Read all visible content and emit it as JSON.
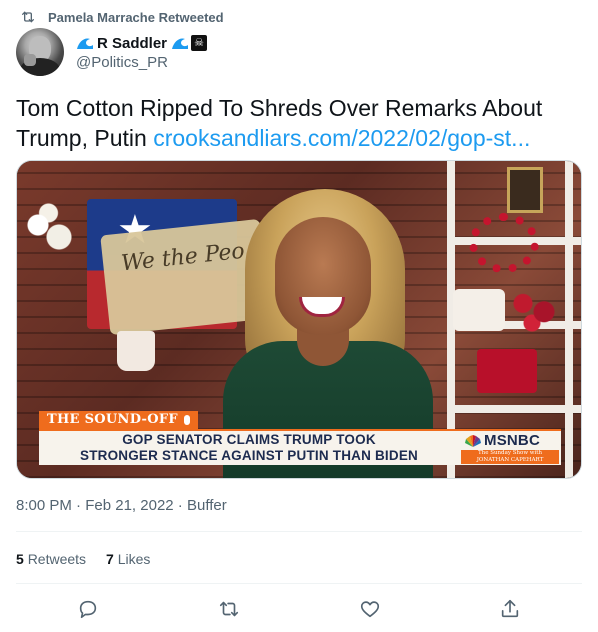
{
  "retweet_bar": {
    "icon": "retweet-icon",
    "text": "Pamela Marrache Retweeted"
  },
  "author": {
    "avatar": "avatar",
    "display_name": "R Saddler",
    "badges": [
      "wave-icon",
      "wave-icon",
      "pirate-flag-icon"
    ],
    "handle": "@Politics_PR"
  },
  "tweet": {
    "text": "Tom Cotton Ripped To Shreds Over Remarks About Trump, Putin ",
    "link": "crooksandliars.com/2022/02/gop-st..."
  },
  "media": {
    "sound_off": "THE SOUND-OFF",
    "headline_line1": "GOP SENATOR CLAIMS TRUMP TOOK",
    "headline_line2": "STRONGER STANCE AGAINST PUTIN THAN BIDEN",
    "network": "MSNBC",
    "show_line1": "The Sunday Show with",
    "show_line2": "JONATHAN CAPEHART",
    "constitution_script": "We the Peo"
  },
  "meta": {
    "time": "8:00 PM",
    "separator": " · ",
    "date": "Feb 21, 2022",
    "source": "Buffer"
  },
  "stats": {
    "retweets_count": "5",
    "retweets_label": "Retweets",
    "likes_count": "7",
    "likes_label": "Likes"
  },
  "actions": {
    "reply": "reply-icon",
    "retweet": "retweet-icon",
    "like": "like-icon",
    "share": "share-icon"
  },
  "colors": {
    "link": "#1d9bf0",
    "secondary_text": "#536471",
    "primary_text": "#0f1419",
    "divider": "#eff3f4",
    "msnbc_orange": "#ef6c1d"
  }
}
